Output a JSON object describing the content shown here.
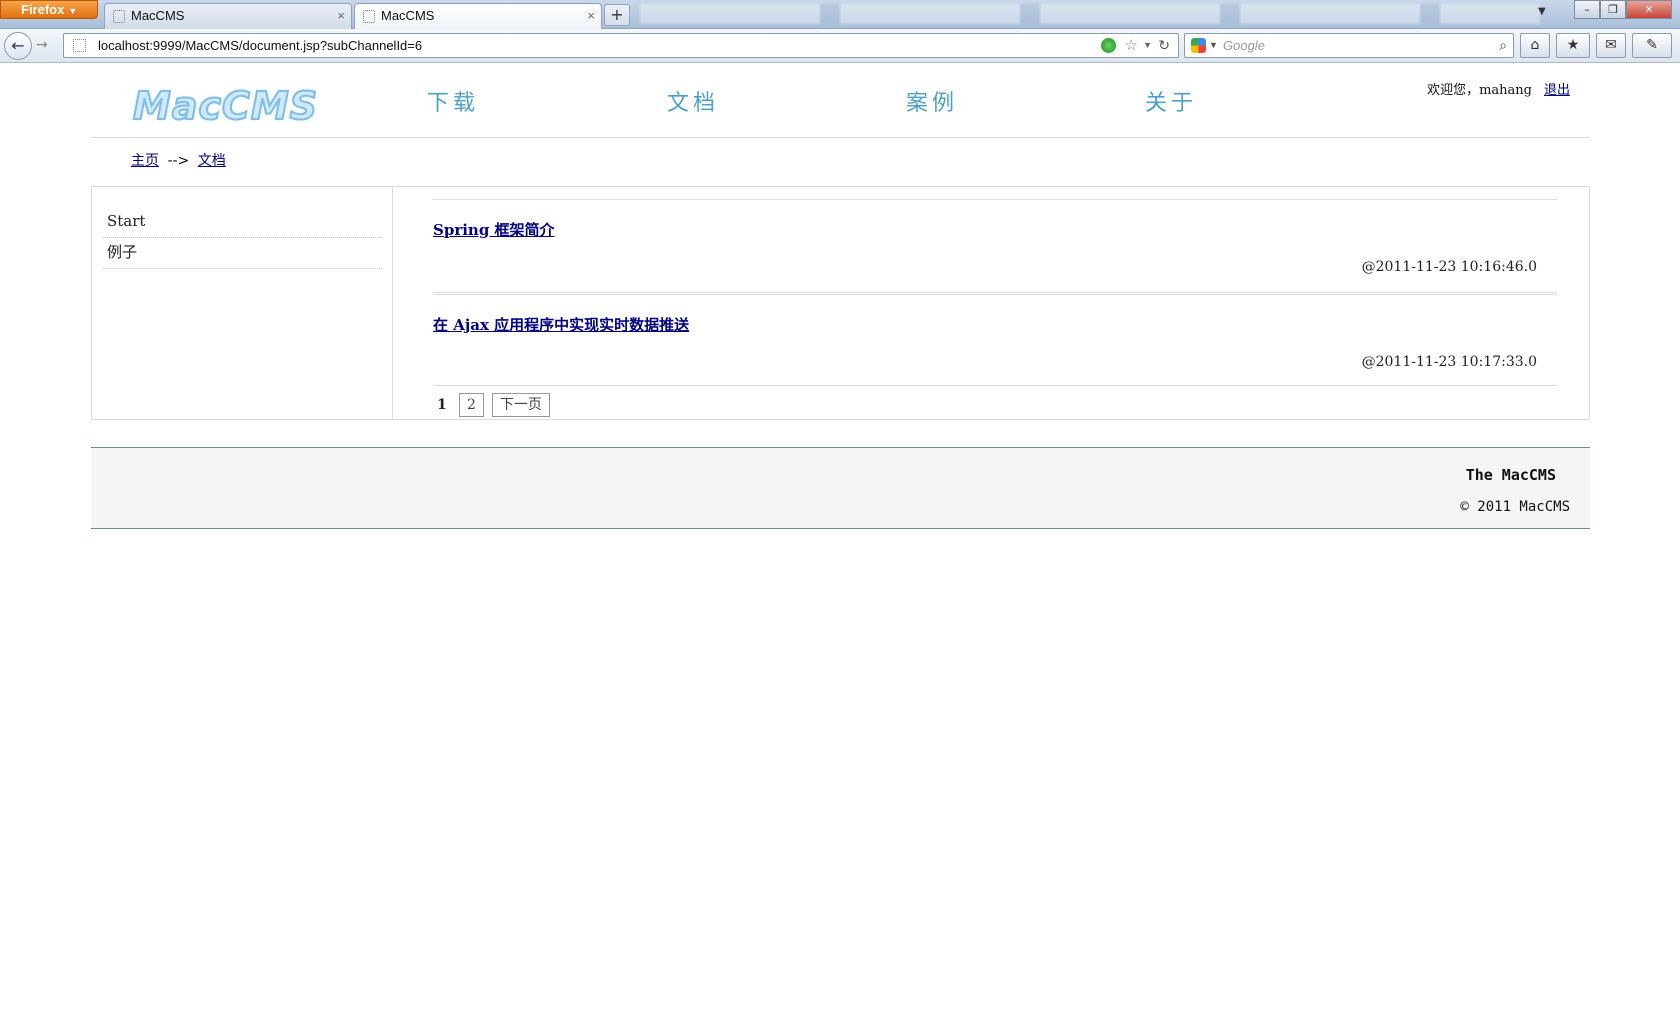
{
  "browser": {
    "menu_button": "Firefox",
    "tabs": [
      {
        "title": "MacCMS",
        "close": "×"
      },
      {
        "title": "MacCMS",
        "close": "×"
      }
    ],
    "new_tab": "+",
    "url": "localhost:9999/MacCMS/document.jsp?subChannelId=6",
    "search_placeholder": "Google"
  },
  "site": {
    "logo": "MacCMS",
    "nav": [
      "下载",
      "文档",
      "案例",
      "关于"
    ],
    "welcome": "欢迎您，mahang",
    "logout": "退出"
  },
  "breadcrumb": {
    "home": "主页",
    "separator": "-->",
    "current": "文档"
  },
  "sidebar": {
    "items": [
      {
        "label": "Start"
      },
      {
        "label": "例子"
      }
    ]
  },
  "documents": [
    {
      "title": "Spring 框架简介",
      "date": "@2011-11-23 10:16:46.0"
    },
    {
      "title": "在 Ajax 应用程序中实现实时数据推送",
      "date": "@2011-11-23 10:17:33.0"
    }
  ],
  "pager": {
    "current": "1",
    "page2": "2",
    "next": "下一页"
  },
  "footer": {
    "line1": "The MacCMS",
    "line2": "© 2011 MacCMS"
  },
  "colors": {
    "link": "#000080",
    "nav": "#4da0c8",
    "footer_border": "#6c8aa1"
  }
}
